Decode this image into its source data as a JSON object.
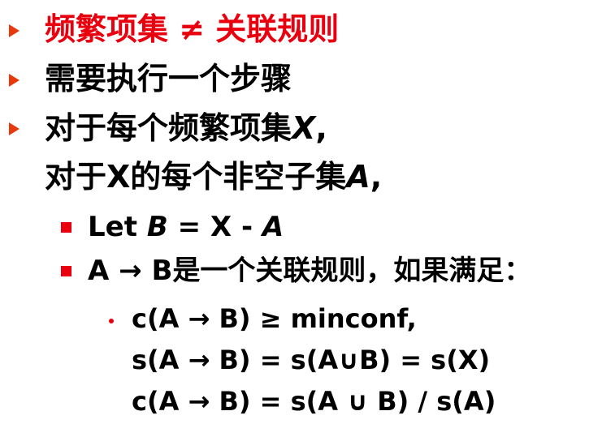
{
  "colors": {
    "accent": "#e8000f",
    "bullet_arrow": "#e8380d",
    "text": "#000000"
  },
  "lines": [
    {
      "level": 1,
      "text": "频繁项集 ≠ 关联规则",
      "color": "red",
      "bullet": "arrow"
    },
    {
      "level": 1,
      "text": "需要执行一个步骤",
      "bullet": "arrow"
    },
    {
      "level": 1,
      "text_a": "对于每个频繁项集",
      "var": "X",
      "text_b": ",",
      "bullet": "arrow"
    },
    {
      "level": 1,
      "text_a": "对于X的每个非空子集",
      "var": "A",
      "text_b": ",",
      "bullet": "none"
    },
    {
      "level": 2,
      "text_a": "Let ",
      "var_b": "B",
      "text_mid": " = X - ",
      "var_a": "A",
      "bullet": "square"
    },
    {
      "level": 2,
      "text": "A → B是一个关联规则，如果满足：",
      "bullet": "square"
    },
    {
      "level": 3,
      "text": "c(A → B) ≥ minconf,",
      "bullet": "dot"
    },
    {
      "level": 3,
      "text": "s(A → B) = s(A∪B) = s(X)",
      "bullet": "none"
    },
    {
      "level": 3,
      "text": "c(A → B) = s(A ∪ B) / s(A)",
      "bullet": "none"
    }
  ]
}
